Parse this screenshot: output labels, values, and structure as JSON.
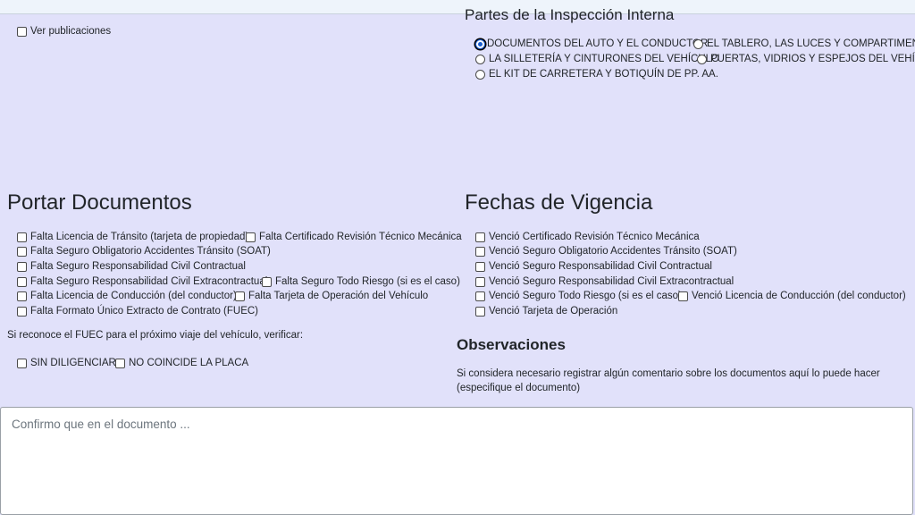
{
  "ver_publicaciones": "Ver publicaciones",
  "partes": {
    "title": "Partes de la Inspección Interna",
    "options": [
      "DOCUMENTOS DEL AUTO Y EL CONDUCTOR",
      "EL TABLERO, LAS LUCES Y COMPARTIMENTOS",
      "LA SILLETERÍA Y CINTURONES DEL VEHÍCULO",
      "PUERTAS, VIDRIOS Y ESPEJOS DEL VEHÍCULO",
      "EL KIT DE CARRETERA Y BOTIQUÍN DE PP. AA."
    ],
    "selected": "DOCUMENTOS DEL AUTO Y EL CONDUCTOR"
  },
  "portar": {
    "title": "Portar Documentos",
    "items": [
      "Falta Licencia de Tránsito (tarjeta de propiedad)",
      "Falta Certificado Revisión Técnico Mecánica",
      "Falta Seguro Obligatorio Accidentes Tránsito (SOAT)",
      "Falta Seguro Responsabilidad Civil Contractual",
      "Falta Seguro Responsabilidad Civil Extracontractual",
      "Falta Seguro Todo Riesgo (si es el caso)",
      "Falta Licencia de Conducción (del conductor)",
      "Falta Tarjeta de Operación del Vehículo",
      "Falta Formato Único Extracto de Contrato (FUEC)"
    ]
  },
  "fuec": {
    "note": "Si reconoce el FUEC para el próximo viaje del vehículo, verificar:",
    "items": [
      "SIN DILIGENCIAR",
      "NO COINCIDE LA PLACA"
    ]
  },
  "fechas": {
    "title": "Fechas de Vigencia",
    "items": [
      "Venció Certificado Revisión Técnico Mecánica",
      "Venció Seguro Obligatorio Accidentes Tránsito (SOAT)",
      "Venció Seguro Responsabilidad Civil Contractual",
      "Venció Seguro Responsabilidad Civil Extracontractual",
      "Venció Seguro Todo Riesgo (si es el caso)",
      "Venció Licencia de Conducción (del conductor)",
      "Venció Tarjeta de Operación"
    ]
  },
  "observaciones": {
    "title": "Observaciones",
    "note": "Si considera necesario registrar algún comentario sobre los documentos aquí lo puede hacer (especifique el documento)",
    "placeholder": "Confirmo que en el documento ..."
  }
}
